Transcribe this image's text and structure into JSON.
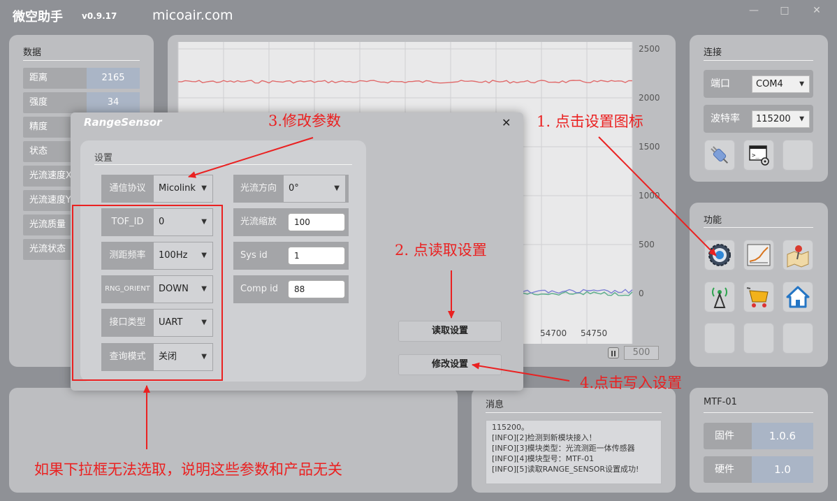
{
  "app": {
    "title": "微空助手",
    "version": "v0.9.17",
    "site": "micoair.com"
  },
  "window_controls": {
    "minimize": "—",
    "maximize": "□",
    "close": "✕"
  },
  "data_panel": {
    "title": "数据",
    "rows": [
      {
        "label": "距离",
        "value": "2165"
      },
      {
        "label": "强度",
        "value": "34"
      },
      {
        "label": "精度",
        "value": ""
      },
      {
        "label": "状态",
        "value": ""
      },
      {
        "label": "光流速度X",
        "value": ""
      },
      {
        "label": "光流速度Y",
        "value": ""
      },
      {
        "label": "光流质量",
        "value": ""
      },
      {
        "label": "光流状态",
        "value": ""
      }
    ]
  },
  "chart_data": {
    "type": "line",
    "y_ticks": [
      "2500",
      "2000",
      "1500",
      "1000",
      "500",
      "0"
    ],
    "x_ticks": [
      "54700",
      "54750"
    ],
    "ylim": [
      0,
      2500
    ],
    "series": [
      {
        "color": "#e06a6a",
        "y_level": 2165
      },
      {
        "color": "#5aae8a",
        "y_level": 0
      },
      {
        "color": "#7b7fd4",
        "y_level": 20
      }
    ],
    "window_value": "500",
    "pause_icon": "pause-icon"
  },
  "connection": {
    "title": "连接",
    "port_label": "端口",
    "port_value": "COM4",
    "baud_label": "波特率",
    "baud_value": "115200",
    "icons": [
      "plug-icon",
      "terminal-settings-icon",
      "empty-tile"
    ]
  },
  "functions": {
    "title": "功能",
    "icons": [
      "settings-gear-icon",
      "chart-icon",
      "map-pin-icon",
      "antenna-icon",
      "cart-icon",
      "home-icon",
      "empty-tile",
      "empty-tile",
      "empty-tile"
    ]
  },
  "messages": {
    "title": "消息",
    "lines": [
      "115200。",
      "[INFO][2]检测到新模块接入！",
      "[INFO][3]模块类型：光流测距一体传感器",
      "[INFO][4]模块型号：MTF-01",
      "[INFO][5]读取RANGE_SENSOR设置成功!"
    ]
  },
  "module": {
    "title": "MTF-01",
    "firmware_label": "固件",
    "firmware_value": "1.0.6",
    "hardware_label": "硬件",
    "hardware_value": "1.0"
  },
  "dialog": {
    "title": "RangeSensor",
    "close": "✕",
    "group_title": "设置",
    "left_fields": [
      {
        "label": "通信协议",
        "value": "Micolink"
      },
      {
        "label": "TOF_ID",
        "value": "0"
      },
      {
        "label": "测距频率",
        "value": "100Hz"
      },
      {
        "label": "RNG_ORIENT",
        "value": "DOWN"
      },
      {
        "label": "接口类型",
        "value": "UART"
      },
      {
        "label": "查询模式",
        "value": "关闭"
      }
    ],
    "right_fields": [
      {
        "label": "光流方向",
        "value": "0°"
      },
      {
        "label": "光流缩放",
        "value": "100"
      },
      {
        "label": "Sys id",
        "value": "1"
      },
      {
        "label": "Comp id",
        "value": "88"
      }
    ],
    "read_button": "读取设置",
    "write_button": "修改设置"
  },
  "annotations": {
    "step1": "1. 点击设置图标",
    "step2": "2. 点读取设置",
    "step3": "3.修改参数",
    "step4": "4.点击写入设置",
    "note": "如果下拉框无法选取，说明这些参数和产品无关"
  },
  "colors": {
    "accent_red": "#ea2121",
    "value_blue": "#aab5c6",
    "background": "#8f9196"
  }
}
